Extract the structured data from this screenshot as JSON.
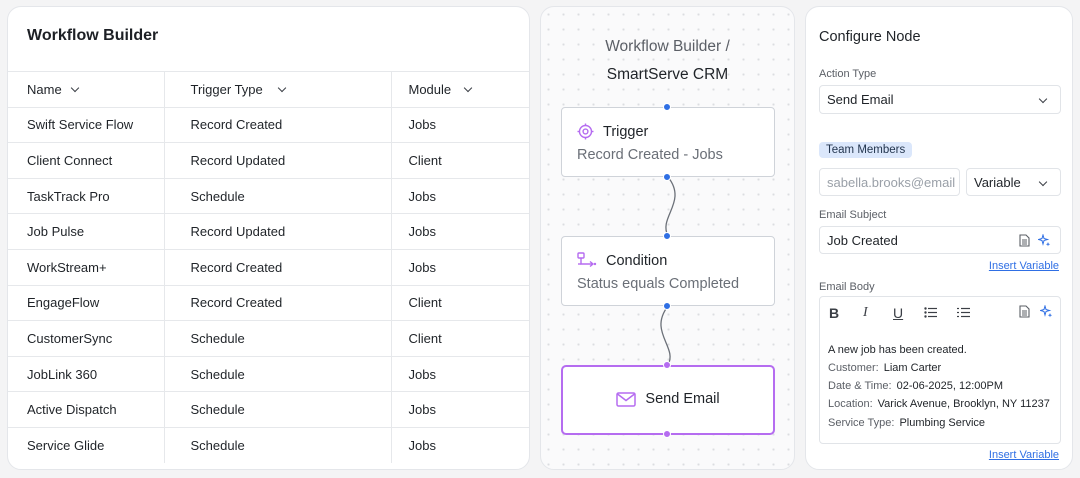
{
  "table": {
    "title": "Workflow Builder",
    "headers": [
      "Name",
      "Trigger Type",
      "Module"
    ],
    "rows": [
      [
        "Swift Service Flow",
        "Record Created",
        "Jobs"
      ],
      [
        "Client Connect",
        "Record Updated",
        "Client"
      ],
      [
        "TaskTrack Pro",
        "Schedule",
        "Jobs"
      ],
      [
        "Job Pulse",
        "Record Updated",
        "Jobs"
      ],
      [
        "WorkStream+",
        "Record Created",
        "Jobs"
      ],
      [
        "EngageFlow",
        "Record Created",
        "Client"
      ],
      [
        "CustomerSync",
        "Schedule",
        "Client"
      ],
      [
        "JobLink 360",
        "Schedule",
        "Jobs"
      ],
      [
        "Active Dispatch",
        "Schedule",
        "Jobs"
      ],
      [
        "Service Glide",
        "Schedule",
        "Jobs"
      ]
    ]
  },
  "flow": {
    "title_line1": "Workflow Builder /",
    "title_line2": "SmartServe CRM",
    "trigger": {
      "title": "Trigger",
      "subtitle": "Record Created - Jobs",
      "icon": "target-icon"
    },
    "condition": {
      "title": "Condition",
      "subtitle": "Status equals Completed",
      "icon": "branch-icon"
    },
    "action": {
      "title": "Send Email",
      "icon": "mail-icon"
    },
    "colors": {
      "connector": "#2f6fe4",
      "selected": "#b56cf0"
    }
  },
  "config": {
    "title": "Configure Node",
    "action_type_label": "Action Type",
    "action_type_value": "Send Email",
    "team_members_badge": "Team Members",
    "recipient_placeholder": "sabella.brooks@email",
    "recipient_type": "Variable",
    "subject_label": "Email Subject",
    "subject_value": "Job Created",
    "insert_variable": "Insert Variable",
    "body_label": "Email Body",
    "toolbar": [
      "B",
      "I",
      "U"
    ],
    "body": {
      "intro": "A new job has been created.",
      "lines": [
        {
          "key": "Customer:",
          "value": "Liam Carter"
        },
        {
          "key": "Date & Time:",
          "value": "02-06-2025, 12:00PM"
        },
        {
          "key": "Location:",
          "value": "Varick Avenue, Brooklyn, NY 11237"
        },
        {
          "key": "Service Type:",
          "value": "Plumbing Service"
        }
      ]
    },
    "link_color": "#2f6fe4"
  }
}
